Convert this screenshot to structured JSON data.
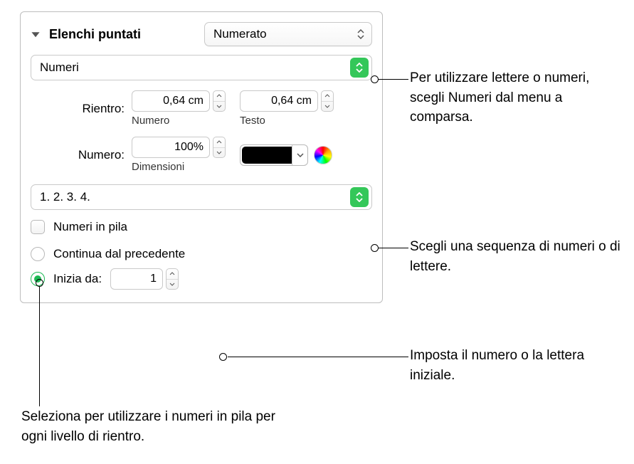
{
  "section": {
    "title": "Elenchi puntati"
  },
  "style_popup": {
    "value": "Numerato"
  },
  "type_popup": {
    "value": "Numeri"
  },
  "rientro": {
    "label": "Rientro:",
    "numero": {
      "value": "0,64 cm",
      "sublabel": "Numero"
    },
    "testo": {
      "value": "0,64 cm",
      "sublabel": "Testo"
    }
  },
  "numero": {
    "label": "Numero:",
    "dimensioni": {
      "value": "100%",
      "sublabel": "Dimensioni"
    }
  },
  "sequence_popup": {
    "value": "1. 2. 3. 4."
  },
  "tiered": {
    "label": "Numeri in pila"
  },
  "continue": {
    "label": "Continua dal precedente"
  },
  "start": {
    "label": "Inizia da:",
    "value": "1"
  },
  "annotations": {
    "type": "Per utilizzare lettere o numeri, scegli Numeri dal menu a comparsa.",
    "sequence": "Scegli una sequenza di numeri o di lettere.",
    "start": "Imposta il numero o la lettera iniziale.",
    "tiered": "Seleziona per utilizzare i numeri in pila per ogni livello di rientro."
  }
}
